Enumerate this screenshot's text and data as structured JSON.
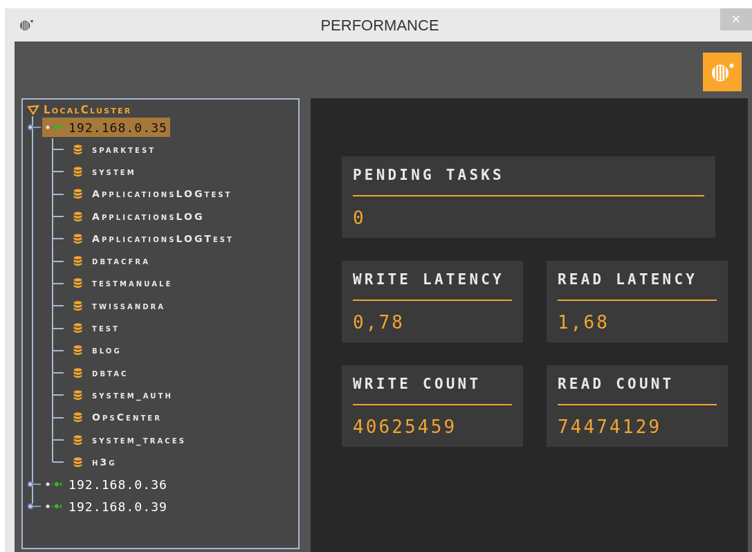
{
  "window": {
    "title": "PERFORMANCE",
    "close": "×"
  },
  "tree": {
    "cluster": "LocalCluster",
    "nodes": [
      {
        "label": "192.168.0.35",
        "selected": true,
        "expanded": true,
        "children": [
          {
            "label": "sparktest"
          },
          {
            "label": "system"
          },
          {
            "label": "ApplicationsLOGtest"
          },
          {
            "label": "ApplicationsLOG"
          },
          {
            "label": "ApplicationsLOGTest"
          },
          {
            "label": "dbtacfra"
          },
          {
            "label": "testmanuale"
          },
          {
            "label": "twissandra"
          },
          {
            "label": "test"
          },
          {
            "label": "blog"
          },
          {
            "label": "dbtac"
          },
          {
            "label": "system_auth"
          },
          {
            "label": "OpsCenter"
          },
          {
            "label": "system_traces"
          },
          {
            "label": "h3g"
          }
        ]
      },
      {
        "label": "192.168.0.36",
        "selected": false,
        "expanded": false
      },
      {
        "label": "192.168.0.39",
        "selected": false,
        "expanded": false
      }
    ]
  },
  "metrics": [
    {
      "title": "PENDING TASKS",
      "value": "0"
    },
    {
      "title": "WRITE LATENCY",
      "value": "0,78"
    },
    {
      "title": "READ LATENCY",
      "value": "1,68"
    },
    {
      "title": "WRITE COUNT",
      "value": "40625459"
    },
    {
      "title": "READ COUNT",
      "value": "74474129"
    }
  ]
}
